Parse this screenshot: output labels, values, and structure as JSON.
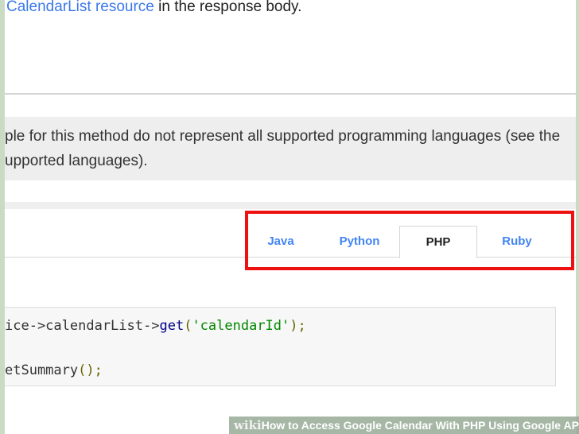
{
  "doc": {
    "top_link": "CalendarList resource",
    "top_rest": " in the response body.",
    "note_line1": "ple for this method do not represent all supported programming languages (see the",
    "note_line2": "upported languages)."
  },
  "tabs": [
    {
      "label": "Java",
      "active": false
    },
    {
      "label": "Python",
      "active": false
    },
    {
      "label": "PHP",
      "active": true
    },
    {
      "label": "Ruby",
      "active": false
    }
  ],
  "code": {
    "line1_prefix": "ice->calendarList->",
    "line1_fn": "get",
    "line1_open": "(",
    "line1_arg": "'calendarId'",
    "line1_close": ");",
    "line2_fn": "etSummary",
    "line2_rest": "();"
  },
  "footer": {
    "brand": "wiki",
    "title_how": "How",
    "title_rest": " to Access Google Calendar With PHP Using Google API"
  },
  "colors": {
    "link": "#3b78e7",
    "tab": "#4285f4",
    "highlight": "#ee1111"
  }
}
